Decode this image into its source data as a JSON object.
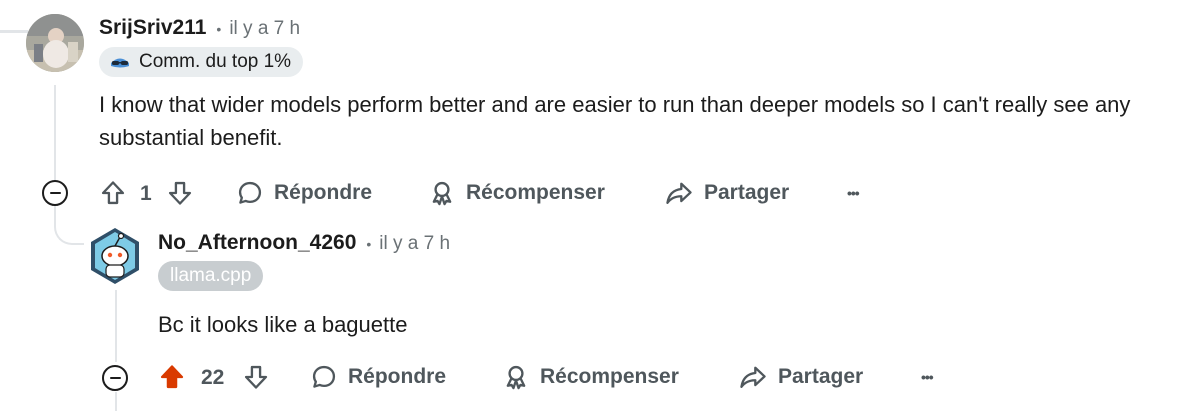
{
  "colors": {
    "upvote_active": "#d93a00",
    "action_gray": "#4f575c",
    "flair_bg": "#e9edef",
    "flair_llama_bg": "#c8cdd0"
  },
  "comments": [
    {
      "username": "SrijSriv211",
      "separator": "•",
      "time": "il y a 7 h",
      "flair": {
        "icon": "sunglasses-emoji-icon",
        "text": "Comm. du top 1%"
      },
      "body": "I know that wider models perform better and are easier to run than deeper models so I can't really see any substantial benefit.",
      "score": "1",
      "upvoted": false,
      "actions": {
        "reply": "Répondre",
        "award": "Récompenser",
        "share": "Partager",
        "more": "•••"
      }
    },
    {
      "username": "No_Afternoon_4260",
      "separator": "•",
      "time": "il y a 7 h",
      "flair": {
        "text": "llama.cpp"
      },
      "body": "Bc it looks like a baguette",
      "score": "22",
      "upvoted": true,
      "actions": {
        "reply": "Répondre",
        "award": "Récompenser",
        "share": "Partager",
        "more": "•••"
      }
    }
  ]
}
